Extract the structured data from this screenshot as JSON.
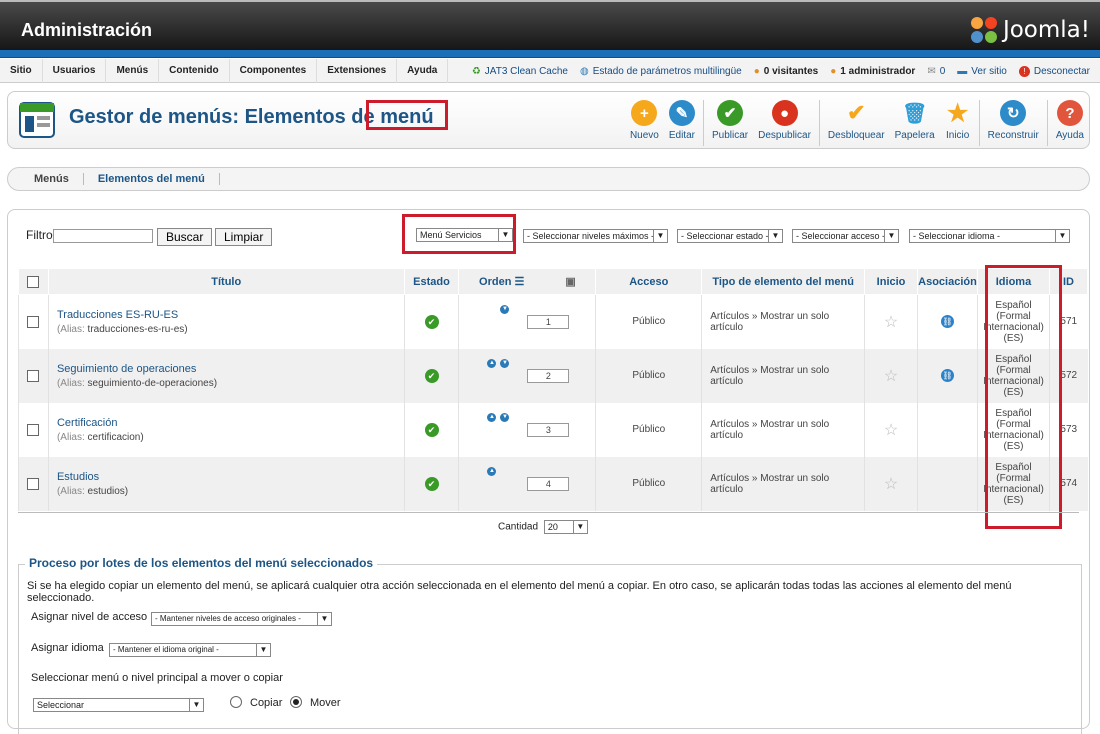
{
  "app": {
    "title": "Administración",
    "logo": "Joomla!"
  },
  "menu": [
    "Sitio",
    "Usuarios",
    "Menús",
    "Contenido",
    "Componentes",
    "Extensiones",
    "Ayuda"
  ],
  "status": {
    "cache": "JAT3 Clean Cache",
    "multilang": "Estado de parámetros multilingüe",
    "visitors": "0 visitantes",
    "admins": "1 administrador",
    "messages": "0",
    "view_site": "Ver sitio",
    "logout": "Desconectar"
  },
  "page": {
    "title_prefix": "Gestor de menús: Elementos de",
    "title_word": "menú"
  },
  "toolbar": [
    {
      "label": "Nuevo",
      "icon": "new-icon",
      "color": "#f5a81b",
      "glyph": "+"
    },
    {
      "label": "Editar",
      "icon": "edit-icon",
      "color": "#2e8bc9",
      "glyph": "✎"
    },
    {
      "label": "Publicar",
      "icon": "publish-icon",
      "color": "#3a9a27",
      "glyph": "✔"
    },
    {
      "label": "Despublicar",
      "icon": "unpublish-icon",
      "color": "#d9331f",
      "glyph": "●"
    },
    {
      "label": "Desbloquear",
      "icon": "checkin-icon",
      "color": "#f5a81b",
      "glyph": "✔"
    },
    {
      "label": "Papelera",
      "icon": "trash-icon",
      "color": "#2e9dd8",
      "glyph": "🗑"
    },
    {
      "label": "Inicio",
      "icon": "home-star-icon",
      "color": "#f5a81b",
      "glyph": "★"
    },
    {
      "label": "Reconstruir",
      "icon": "rebuild-icon",
      "color": "#2e8bc9",
      "glyph": "↻"
    },
    {
      "label": "Ayuda",
      "icon": "help-icon",
      "color": "#e2553d",
      "glyph": "?"
    }
  ],
  "subnav": [
    "Menús",
    "Elementos del menú"
  ],
  "filter": {
    "label": "Filtro:",
    "value": "",
    "search_button": "Buscar",
    "clear_button": "Limpiar",
    "menu_select": "Menú Servicios",
    "levels_select": "- Seleccionar niveles máximos -",
    "state_select": "- Seleccionar estado -",
    "access_select": "- Seleccionar acceso -",
    "language_select": "- Seleccionar idioma -"
  },
  "columns": {
    "title": "Título",
    "state": "Estado",
    "order": "Orden",
    "access": "Acceso",
    "type": "Tipo de elemento del menú",
    "home": "Inicio",
    "assoc": "Asociación",
    "language": "Idioma",
    "id": "ID"
  },
  "rows": [
    {
      "title": "Traducciones ES-RU-ES",
      "alias_label": "(Alias:",
      "alias": "traducciones-es-ru-es)",
      "order": "1",
      "access": "Público",
      "type": "Artículos » Mostrar un solo artículo",
      "lang1": "Español",
      "lang2": "(Formal",
      "lang3": "Internacional)",
      "lang4": "(ES)",
      "id": "571"
    },
    {
      "title": "Seguimiento de operaciones",
      "alias_label": "(Alias:",
      "alias": "seguimiento-de-operaciones)",
      "order": "2",
      "access": "Público",
      "type": "Artículos » Mostrar un solo artículo",
      "lang1": "Español",
      "lang2": "(Formal",
      "lang3": "Internacional)",
      "lang4": "(ES)",
      "id": "572"
    },
    {
      "title": "Certificación",
      "alias_label": "(Alias:",
      "alias": "certificacion)",
      "order": "3",
      "access": "Público",
      "type": "Artículos » Mostrar un solo artículo",
      "lang1": "Español",
      "lang2": "(Formal",
      "lang3": "Internacional)",
      "lang4": "(ES)",
      "id": "573"
    },
    {
      "title": "Estudios",
      "alias_label": "(Alias:",
      "alias": "estudios)",
      "order": "4",
      "access": "Público",
      "type": "Artículos » Mostrar un solo artículo",
      "lang1": "Español",
      "lang2": "(Formal",
      "lang3": "Internacional)",
      "lang4": "(ES)",
      "id": "574"
    }
  ],
  "pagination": {
    "label": "Cantidad",
    "value": "20"
  },
  "batch": {
    "legend": "Proceso por lotes de los elementos del menú seleccionados",
    "note": "Si se ha elegido copiar un elemento del menú, se aplicará cualquier otra acción seleccionada en el elemento del menú a copiar. En otro caso, se aplicarán todas todas las acciones al elemento del menú seleccionado.",
    "access_label": "Asignar nivel de acceso",
    "access_value": "- Mantener niveles de acceso originales -",
    "lang_label": "Asignar idioma",
    "lang_value": "- Mantener el idioma original -",
    "move_label": "Seleccionar menú o nivel principal a mover o copiar",
    "move_value": "Seleccionar",
    "copy": "Copiar",
    "move": "Mover"
  }
}
